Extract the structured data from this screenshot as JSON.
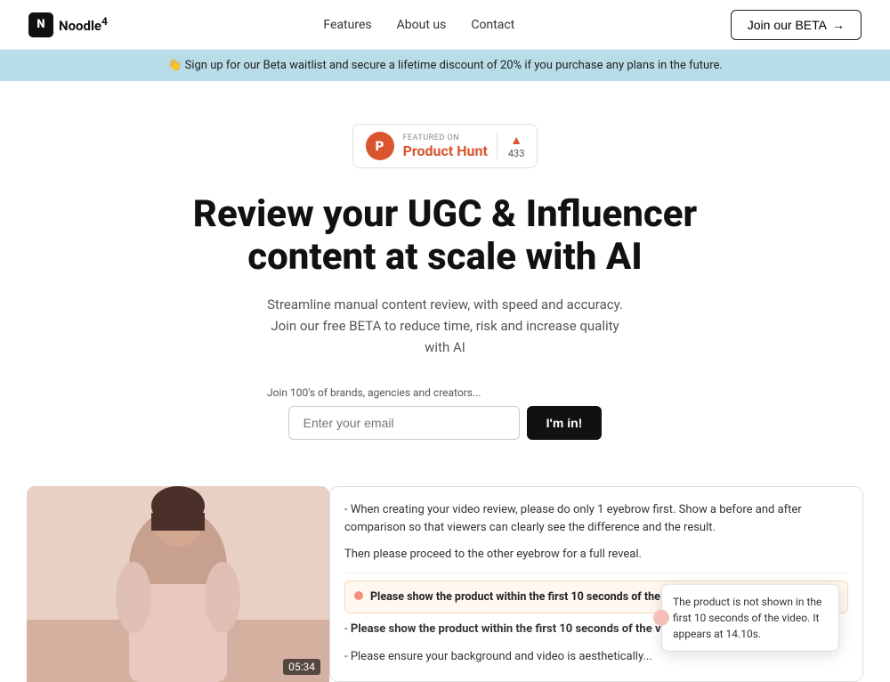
{
  "nav": {
    "logo_letter": "N",
    "logo_name": "Noodle",
    "logo_suffix": "4",
    "links": [
      "Features",
      "About us",
      "Contact"
    ],
    "cta_label": "Join our BETA",
    "cta_arrow": "→"
  },
  "banner": {
    "emoji": "👋",
    "text": "Sign up for our Beta waitlist and secure a lifetime discount of 20% if you purchase any plans in the future."
  },
  "hero": {
    "ph_featured": "FEATURED ON",
    "ph_name": "Product Hunt",
    "ph_count": "433",
    "ph_triangle": "▲",
    "headline_line1": "Review your UGC & Influencer",
    "headline_line2": "content at scale with AI",
    "subtext": "Streamline manual content review, with speed and accuracy. Join our free BETA to reduce time, risk and increase quality with AI",
    "form_label": "Join 100's of brands, agencies and creators...",
    "email_placeholder": "Enter your email",
    "submit_label": "I'm in!"
  },
  "video": {
    "timestamp": "05:34"
  },
  "review": {
    "items": [
      {
        "text": "- When creating your video review, please do only 1 eyebrow first. Show a before and after comparison so that viewers can clearly see the difference and the result.",
        "bold": false
      },
      {
        "text": "Then please proceed to the other eyebrow for a full reveal.",
        "bold": false
      },
      {
        "text": "- Please show the product within the first 10 seconds of the video.",
        "bold": true,
        "inline_alert": true,
        "alert_text": "The product is not shown in the first 10 seconds of the video. It appears at 14.10s."
      },
      {
        "text": "- Please show the product within the first 10 seconds of the video.",
        "bold": true
      },
      {
        "text": "- Please ensure your background and video is aesthetically...",
        "bold": false
      }
    ]
  }
}
